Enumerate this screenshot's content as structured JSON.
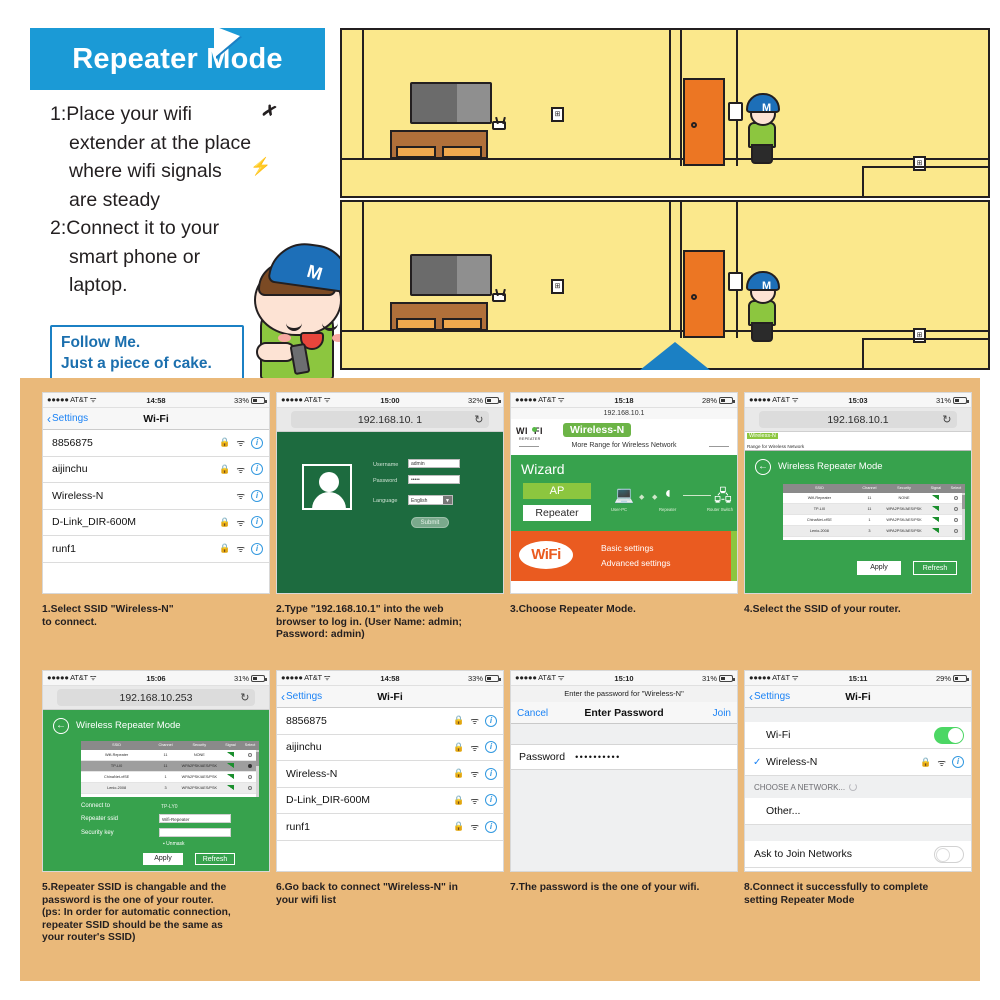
{
  "header": {
    "title": "Repeater Mode",
    "steps": [
      "1:Place your wifi",
      "extender at the place",
      "where wifi signals",
      "are steady",
      "2:Connect it to your",
      "smart phone or",
      "laptop."
    ],
    "bubble_line1": "Follow Me.",
    "bubble_line2": "Just a piece of cake.",
    "cap_logo": "M"
  },
  "colors": {
    "brand_blue": "#1b9ad6",
    "router_green": "#37a24d",
    "login_green": "#1d6b3f",
    "orange": "#ea5b20",
    "panel_bg": "#eab97a",
    "scene_yellow": "#fbe88c",
    "door_orange": "#ec7623",
    "ios_blue": "#1a82f5",
    "toggle_green": "#4cd764"
  },
  "panels": [
    {
      "id": "p1",
      "kind": "wifi-list",
      "status": {
        "carrier": "AT&T",
        "time": "14:58",
        "battery": "33%"
      },
      "nav": {
        "back": "Settings",
        "title": "Wi-Fi"
      },
      "networks": [
        {
          "name": "8856875",
          "lock": true
        },
        {
          "name": "aijinchu",
          "lock": true
        },
        {
          "name": "Wireless-N",
          "lock": false
        },
        {
          "name": "D-Link_DIR-600M",
          "lock": true
        },
        {
          "name": "runf1",
          "lock": true
        }
      ],
      "caption": "1.Select SSID \"Wireless-N\"\nto connect."
    },
    {
      "id": "p2",
      "kind": "router-login",
      "status": {
        "carrier": "AT&T",
        "time": "15:00",
        "battery": "32%"
      },
      "url": "192.168.10. 1",
      "form": {
        "username_label": "Username",
        "username_value": "admin",
        "password_label": "Password",
        "password_value": "•••••",
        "language_label": "Language",
        "language_value": "English",
        "submit_label": "Submit"
      },
      "caption": "2.Type \"192.168.10.1\" into the web\nbrowser to log in. (User Name: admin;\nPassword: admin)"
    },
    {
      "id": "p3",
      "kind": "wizard",
      "status": {
        "carrier": "AT&T",
        "time": "15:18",
        "battery": "28%"
      },
      "url": "192.168.10.1",
      "logo": {
        "wi": "WI",
        "fi": "FI",
        "sub": "REPEATER"
      },
      "badge": "Wireless-N",
      "tagline": "More Range for Wireless Network",
      "wizard_title": "Wizard",
      "mode_ap": "AP",
      "mode_repeater": "Repeater",
      "devices": [
        "User-PC",
        "Repeater",
        "Router Switch"
      ],
      "orange_logo": "WiFi",
      "orange_items": [
        "Basic settings",
        "Advanced settings"
      ],
      "caption": "3.Choose Repeater Mode."
    },
    {
      "id": "p4",
      "kind": "repeater-mode",
      "status": {
        "carrier": "AT&T",
        "time": "15:03",
        "battery": "31%"
      },
      "url": "192.168.10.1",
      "badge": "Wireless-N",
      "tagline": "Range for Wireless Network",
      "page_title": "Wireless Repeater Mode",
      "table": {
        "headers": [
          "SSID",
          "Channel",
          "Security",
          "Signal",
          "Select"
        ],
        "rows": [
          {
            "ssid": "Wifi-Repeater",
            "channel": "11",
            "security": "NONE",
            "selected": false
          },
          {
            "ssid": "TP-LI0",
            "channel": "11",
            "security": "WPA2PSK/AES/PSK",
            "selected": false
          },
          {
            "ssid": "ChinaNet-xfSE",
            "channel": "1",
            "security": "WPA2PSK/AES/PSK",
            "selected": false
          },
          {
            "ssid": "Lenio-2008",
            "channel": "3",
            "security": "WPA2PSK/AES/PSK",
            "selected": false
          }
        ]
      },
      "apply_label": "Apply",
      "refresh_label": "Refresh",
      "caption": "4.Select the SSID of your router."
    },
    {
      "id": "p5",
      "kind": "repeater-config",
      "status": {
        "carrier": "AT&T",
        "time": "15:06",
        "battery": "31%"
      },
      "url": "192.168.10.253",
      "page_title": "Wireless Repeater Mode",
      "table": {
        "headers": [
          "SSID",
          "Channel",
          "Security",
          "Signal",
          "Select"
        ],
        "rows": [
          {
            "ssid": "Wifi-Repeater",
            "channel": "11",
            "security": "NONE",
            "selected": false
          },
          {
            "ssid": "TP-LI0",
            "channel": "11",
            "security": "WPA2PSK/AES/PSK",
            "selected": true
          },
          {
            "ssid": "ChinaNet-xfSE",
            "channel": "1",
            "security": "WPA2PSK/AES/PSK",
            "selected": false
          },
          {
            "ssid": "Lenio-2008",
            "channel": "3",
            "security": "WPA2PSK/AES/PSK",
            "selected": false
          }
        ]
      },
      "fields": {
        "connect_to_label": "Connect to",
        "connect_to_value": "TP-LY0",
        "repeater_ssid_label": "Repeater ssid",
        "repeater_ssid_value": "Wifi-Repeater",
        "security_key_label": "Security key",
        "security_key_value": "",
        "unmask_label": "Unmask"
      },
      "apply_label": "Apply",
      "refresh_label": "Refresh",
      "caption": "5.Repeater SSID is changable and the\npassword is the one of your router.\n(ps: In order for automatic connection,\nrepeater SSID should be the same as\nyour router's SSID)"
    },
    {
      "id": "p6",
      "kind": "wifi-list",
      "status": {
        "carrier": "AT&T",
        "time": "14:58",
        "battery": "33%"
      },
      "nav": {
        "back": "Settings",
        "title": "Wi-Fi"
      },
      "networks": [
        {
          "name": "8856875",
          "lock": true
        },
        {
          "name": "aijinchu",
          "lock": true
        },
        {
          "name": "Wireless-N",
          "lock": true
        },
        {
          "name": "D-Link_DIR-600M",
          "lock": true
        },
        {
          "name": "runf1",
          "lock": true
        }
      ],
      "caption": "6.Go back to connect \"Wireless-N\" in\nyour wifi list"
    },
    {
      "id": "p7",
      "kind": "enter-password",
      "status": {
        "carrier": "AT&T",
        "time": "15:10",
        "battery": "31%"
      },
      "prompt": "Enter the password for \"Wireless-N\"",
      "cancel_label": "Cancel",
      "title": "Enter Password",
      "join_label": "Join",
      "password_label": "Password",
      "password_value": "••••••••••",
      "caption": "7.The password is the one of your wifi."
    },
    {
      "id": "p8",
      "kind": "wifi-settings",
      "status": {
        "carrier": "AT&T",
        "time": "15:11",
        "battery": "29%"
      },
      "nav": {
        "back": "Settings",
        "title": "Wi-Fi"
      },
      "wifi_label": "Wi-Fi",
      "wifi_on": true,
      "connected_network": "Wireless-N",
      "section_label": "CHOOSE A NETWORK...",
      "other_label": "Other...",
      "ask_to_join_label": "Ask to Join Networks",
      "ask_to_join_on": false,
      "caption": "8.Connect it successfully to complete\nsetting Repeater Mode"
    }
  ],
  "icons": {
    "lock": "🔒",
    "wifi": "◠",
    "info": "i",
    "reload": "↻",
    "back_chevron": "‹",
    "check": "✓"
  }
}
